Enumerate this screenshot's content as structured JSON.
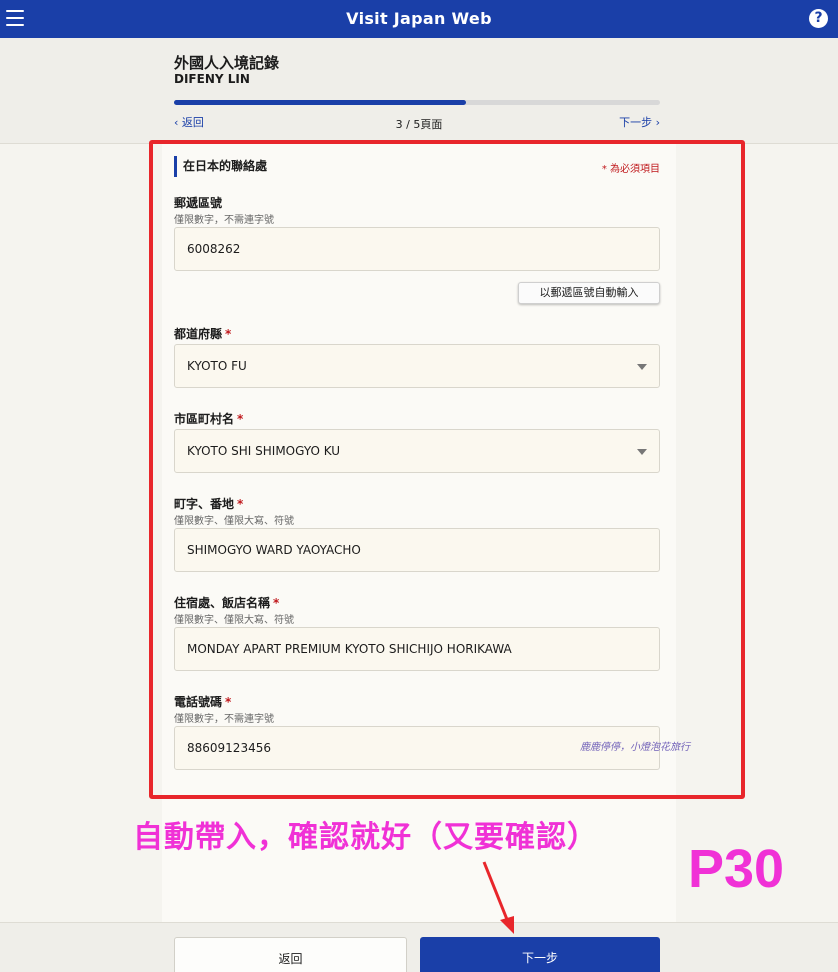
{
  "app": {
    "title": "Visit Japan Web",
    "help_label": "?"
  },
  "header": {
    "title": "外國人入境記錄",
    "name": "DIFENY LIN",
    "progress": 0.6,
    "back_label": "返回",
    "page_indicator": "3 / 5頁面",
    "next_label": "下一步"
  },
  "form": {
    "section_title": "在日本的聯絡處",
    "required_note": "* 為必須項目",
    "postal": {
      "label": "郵遞區號",
      "hint": "僅限數字，不需連字號",
      "value": "6008262",
      "auto_button": "以郵遞區號自動輸入"
    },
    "prefecture": {
      "label": "都道府縣",
      "value": "KYOTO FU"
    },
    "city": {
      "label": "市區町村名",
      "value": "KYOTO SHI SHIMOGYO KU"
    },
    "address": {
      "label": "町字、番地",
      "hint": "僅限數字、僅限大寫、符號",
      "value": "SHIMOGYO WARD YAOYACHO"
    },
    "hotel": {
      "label": "住宿處、飯店名稱",
      "hint": "僅限數字、僅限大寫、符號",
      "value": "MONDAY APART PREMIUM KYOTO SHICHIJO HORIKAWA"
    },
    "phone": {
      "label": "電話號碼",
      "hint": "僅限數字，不需連字號",
      "value": "88609123456"
    },
    "required_star": "*"
  },
  "overlay": {
    "watermark": "鹿鹿停停，小燈泡花旅行",
    "annotation": "自動帶入，確認就好（又要確認）",
    "page_tag": "P30"
  },
  "footer": {
    "back_label": "返回",
    "next_label": "下一步"
  },
  "colors": {
    "brand": "#1a3fa8",
    "required": "#c0181c",
    "annotation": "#f031d6",
    "highlight_box": "#e8262b"
  }
}
